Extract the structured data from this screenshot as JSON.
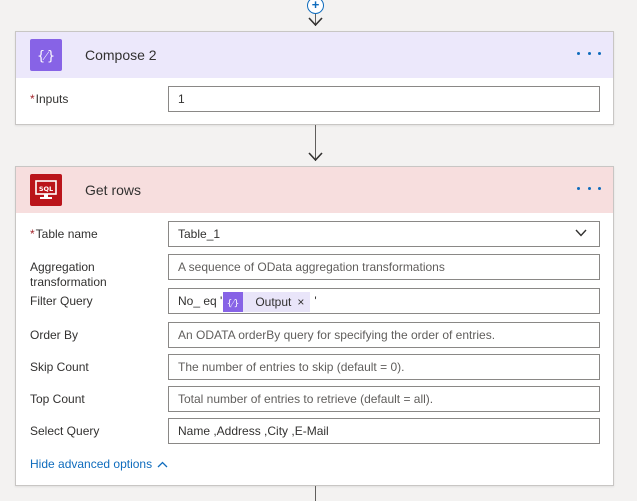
{
  "compose_card": {
    "title": "Compose 2",
    "inputs": {
      "label": "Inputs",
      "required_marker": "*",
      "value": "1"
    }
  },
  "getrows_card": {
    "title": "Get rows",
    "icon_text": "SQL",
    "fields": {
      "table_name": {
        "label": "Table name",
        "required_marker": "*",
        "value": "Table_1"
      },
      "aggregation": {
        "label": "Aggregation transformation",
        "placeholder": "A sequence of OData aggregation transformations"
      },
      "filter_query": {
        "label": "Filter Query",
        "prefix": "No_ eq '",
        "token_label": "Output",
        "token_close": "×",
        "suffix": "'"
      },
      "order_by": {
        "label": "Order By",
        "placeholder": "An ODATA orderBy query for specifying the order of entries."
      },
      "skip_count": {
        "label": "Skip Count",
        "placeholder": "The number of entries to skip (default = 0)."
      },
      "top_count": {
        "label": "Top Count",
        "placeholder": "Total number of entries to retrieve (default = all)."
      },
      "select_query": {
        "label": "Select Query",
        "value": "Name ,Address ,City ,E-Mail"
      }
    },
    "hide_advanced": "Hide advanced options"
  },
  "add_step_symbol": "+",
  "colors": {
    "compose_accent": "#8763e6",
    "sql_accent": "#ba141a",
    "link": "#0f6cbd"
  }
}
